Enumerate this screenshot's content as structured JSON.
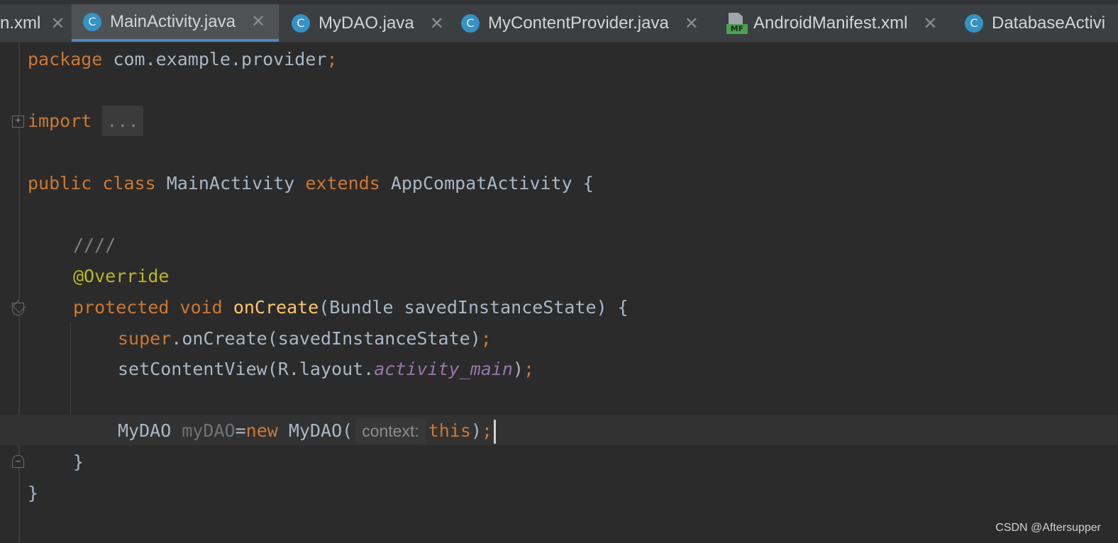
{
  "tabs": [
    {
      "label": "n.xml",
      "icon": "none",
      "active": false
    },
    {
      "label": "MainActivity.java",
      "icon": "java-class-icon",
      "active": true
    },
    {
      "label": "MyDAO.java",
      "icon": "java-class-icon",
      "active": false
    },
    {
      "label": "MyContentProvider.java",
      "icon": "java-class-icon",
      "active": false
    },
    {
      "label": "AndroidManifest.xml",
      "icon": "manifest-icon",
      "active": false
    },
    {
      "label": "DatabaseActivi",
      "icon": "java-class-icon",
      "active": false
    }
  ],
  "icon_glyphs": {
    "class": "C",
    "manifest": "MF",
    "close": "✕"
  },
  "code": {
    "package_kw": "package",
    "package_name": " com.example.provider",
    "semicolon": ";",
    "import_kw": "import",
    "import_folded": "...",
    "public_kw": "public",
    "class_kw": "class",
    "class_name": "MainActivity",
    "extends_kw": "extends",
    "super_class": "AppCompatActivity",
    "open_brace": "{",
    "comment": "////",
    "annotation": "@Override",
    "protected_kw": "protected",
    "void_kw": "void",
    "method_name": "onCreate",
    "params": "(Bundle savedInstanceState) {",
    "super_kw": "super",
    "super_call": ".onCreate(savedInstanceState)",
    "set_content_call": "setContentView(R.layout.",
    "layout_field": "activity_main",
    "close_paren": ")",
    "type_name": "MyDAO",
    "var_name": "myDAO",
    "assign": "=",
    "new_kw": "new",
    "ctor_call": "MyDAO(",
    "param_hint": "context:",
    "this_kw": "this",
    "close_method": "}",
    "close_class": "}"
  },
  "watermark": "CSDN @Aftersupper"
}
